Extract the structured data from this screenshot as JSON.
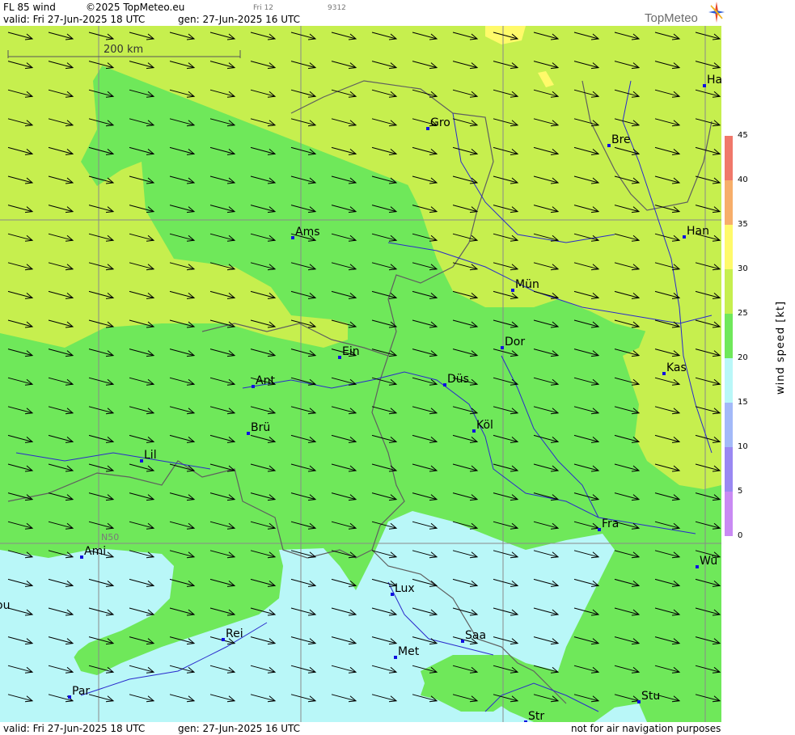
{
  "header": {
    "product": "FL 85 wind",
    "copyright": "©2025 TopMeteo.eu",
    "valid": "valid:  Fri  27-Jun-2025  18 UTC",
    "generated": "gen: 27-Jun-2025 16 UTC",
    "small_day": "Fri 12",
    "small_code": "9312",
    "logo": "TopMeteo"
  },
  "footer": {
    "valid": "valid:  Fri  27-Jun-2025  18 UTC",
    "generated": "gen: 27-Jun-2025 16 UTC",
    "disclaimer": "not for air navigation purposes"
  },
  "map": {
    "scale_label": "200 km",
    "graticule_label": "N50",
    "wind_arrow_direction": "east-southeast",
    "cities": [
      "Ha",
      "Gro",
      "Bre",
      "Ams",
      "Han",
      "Mün",
      "Ein",
      "Dor",
      "Kas",
      "Ant",
      "Düs",
      "Brü",
      "Köl",
      "Lil",
      "Fra",
      "Ami",
      "Wü",
      "Lux",
      "ou",
      "Rei",
      "Saa",
      "Met",
      "Par",
      "Stu",
      "Str"
    ]
  },
  "colorbar": {
    "title": "wind speed [kt]",
    "ticks": [
      "45",
      "40",
      "35",
      "30",
      "25",
      "20",
      "15",
      "10",
      "5",
      "0"
    ],
    "colors": {
      "40-45": "#f0786a",
      "35-40": "#f7ae6a",
      "30-35": "#fffa6a",
      "25-30": "#c6ef4e",
      "20-25": "#6fe85a",
      "15-20": "#b9f7f8",
      "10-15": "#a3b9f8",
      "5-10": "#9a88f2",
      "0-5": "#c98af3"
    }
  }
}
